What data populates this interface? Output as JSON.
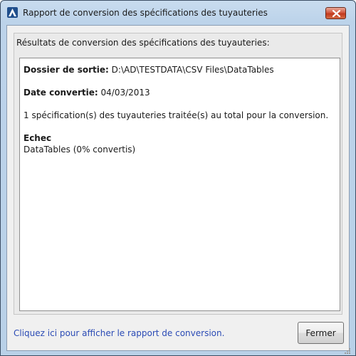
{
  "window": {
    "title": "Rapport de conversion des spécifications des tuyauteries",
    "app_icon": "autodesk-a-icon",
    "close_icon": "close-x-icon",
    "close_color": "#c7482a"
  },
  "group": {
    "label": "Résultats de conversion des spécifications des tuyauteries:"
  },
  "report": {
    "output_folder_label": "Dossier de sortie:",
    "output_folder_value": "D:\\AD\\TESTDATA\\CSV Files\\DataTables",
    "date_label": "Date convertie:",
    "date_value": "04/03/2013",
    "summary": "1 spécification(s) des tuyauteries traitée(s) au total pour la conversion.",
    "failure_heading": "Echec",
    "failure_item": "DataTables (0% convertis)"
  },
  "footer": {
    "link_text": "Cliquez ici pour afficher le rapport de conversion.",
    "close_button": "Fermer",
    "resize_icon": "resize-grip-icon"
  }
}
